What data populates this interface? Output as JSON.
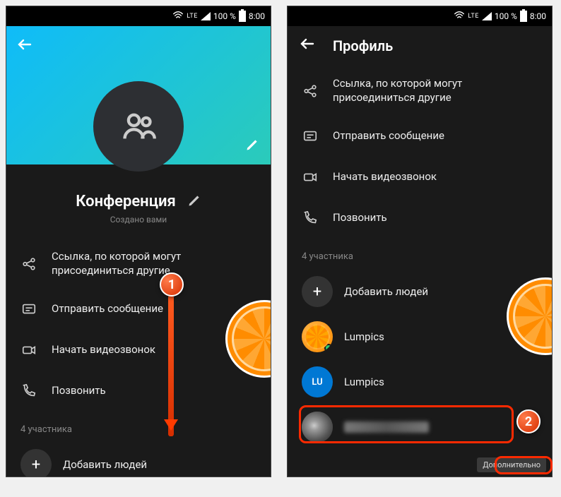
{
  "status": {
    "lte": "LTE",
    "battery_pct": "100 %",
    "time": "8:00"
  },
  "left": {
    "title": "Конференция",
    "subtitle": "Создано вами",
    "actions": {
      "share_link": "Ссылка, по которой могут присоединиться другие",
      "send_message": "Отправить сообщение",
      "video_call": "Начать видеозвонок",
      "call": "Позвонить"
    },
    "participants_label": "4 участника",
    "add_people": "Добавить людей"
  },
  "right": {
    "header": "Профиль",
    "actions": {
      "share_link": "Ссылка, по которой могут присоединиться другие",
      "send_message": "Отправить сообщение",
      "video_call": "Начать видеозвонок",
      "call": "Позвонить"
    },
    "participants_label": "4 участника",
    "add_people": "Добавить людей",
    "people": [
      {
        "name": "Lumpics",
        "avatar": "orange",
        "online": true
      },
      {
        "name": "Lumpics",
        "avatar": "blue",
        "initials": "LU"
      },
      {
        "name": "",
        "avatar": "photo",
        "blurred": true
      }
    ],
    "more": "Дополнительно"
  },
  "markers": {
    "one": "1",
    "two": "2"
  }
}
